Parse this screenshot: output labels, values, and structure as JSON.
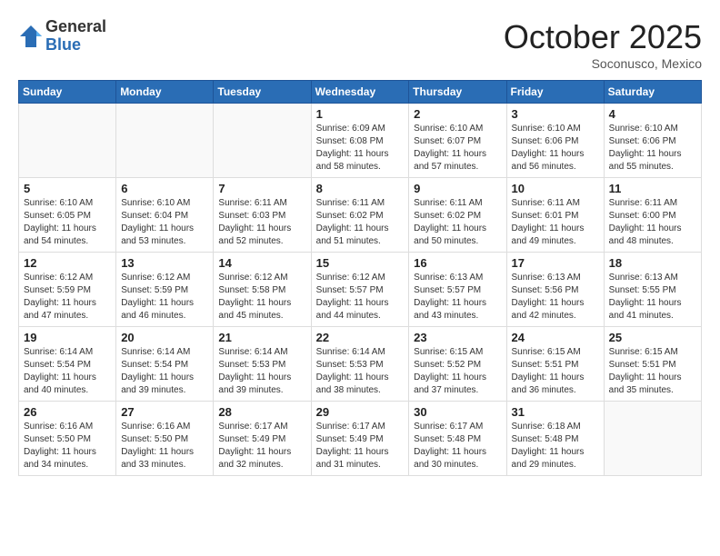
{
  "logo": {
    "general": "General",
    "blue": "Blue"
  },
  "header": {
    "month": "October 2025",
    "location": "Soconusco, Mexico"
  },
  "weekdays": [
    "Sunday",
    "Monday",
    "Tuesday",
    "Wednesday",
    "Thursday",
    "Friday",
    "Saturday"
  ],
  "weeks": [
    [
      {
        "day": "",
        "info": ""
      },
      {
        "day": "",
        "info": ""
      },
      {
        "day": "",
        "info": ""
      },
      {
        "day": "1",
        "info": "Sunrise: 6:09 AM\nSunset: 6:08 PM\nDaylight: 11 hours\nand 58 minutes."
      },
      {
        "day": "2",
        "info": "Sunrise: 6:10 AM\nSunset: 6:07 PM\nDaylight: 11 hours\nand 57 minutes."
      },
      {
        "day": "3",
        "info": "Sunrise: 6:10 AM\nSunset: 6:06 PM\nDaylight: 11 hours\nand 56 minutes."
      },
      {
        "day": "4",
        "info": "Sunrise: 6:10 AM\nSunset: 6:06 PM\nDaylight: 11 hours\nand 55 minutes."
      }
    ],
    [
      {
        "day": "5",
        "info": "Sunrise: 6:10 AM\nSunset: 6:05 PM\nDaylight: 11 hours\nand 54 minutes."
      },
      {
        "day": "6",
        "info": "Sunrise: 6:10 AM\nSunset: 6:04 PM\nDaylight: 11 hours\nand 53 minutes."
      },
      {
        "day": "7",
        "info": "Sunrise: 6:11 AM\nSunset: 6:03 PM\nDaylight: 11 hours\nand 52 minutes."
      },
      {
        "day": "8",
        "info": "Sunrise: 6:11 AM\nSunset: 6:02 PM\nDaylight: 11 hours\nand 51 minutes."
      },
      {
        "day": "9",
        "info": "Sunrise: 6:11 AM\nSunset: 6:02 PM\nDaylight: 11 hours\nand 50 minutes."
      },
      {
        "day": "10",
        "info": "Sunrise: 6:11 AM\nSunset: 6:01 PM\nDaylight: 11 hours\nand 49 minutes."
      },
      {
        "day": "11",
        "info": "Sunrise: 6:11 AM\nSunset: 6:00 PM\nDaylight: 11 hours\nand 48 minutes."
      }
    ],
    [
      {
        "day": "12",
        "info": "Sunrise: 6:12 AM\nSunset: 5:59 PM\nDaylight: 11 hours\nand 47 minutes."
      },
      {
        "day": "13",
        "info": "Sunrise: 6:12 AM\nSunset: 5:59 PM\nDaylight: 11 hours\nand 46 minutes."
      },
      {
        "day": "14",
        "info": "Sunrise: 6:12 AM\nSunset: 5:58 PM\nDaylight: 11 hours\nand 45 minutes."
      },
      {
        "day": "15",
        "info": "Sunrise: 6:12 AM\nSunset: 5:57 PM\nDaylight: 11 hours\nand 44 minutes."
      },
      {
        "day": "16",
        "info": "Sunrise: 6:13 AM\nSunset: 5:57 PM\nDaylight: 11 hours\nand 43 minutes."
      },
      {
        "day": "17",
        "info": "Sunrise: 6:13 AM\nSunset: 5:56 PM\nDaylight: 11 hours\nand 42 minutes."
      },
      {
        "day": "18",
        "info": "Sunrise: 6:13 AM\nSunset: 5:55 PM\nDaylight: 11 hours\nand 41 minutes."
      }
    ],
    [
      {
        "day": "19",
        "info": "Sunrise: 6:14 AM\nSunset: 5:54 PM\nDaylight: 11 hours\nand 40 minutes."
      },
      {
        "day": "20",
        "info": "Sunrise: 6:14 AM\nSunset: 5:54 PM\nDaylight: 11 hours\nand 39 minutes."
      },
      {
        "day": "21",
        "info": "Sunrise: 6:14 AM\nSunset: 5:53 PM\nDaylight: 11 hours\nand 39 minutes."
      },
      {
        "day": "22",
        "info": "Sunrise: 6:14 AM\nSunset: 5:53 PM\nDaylight: 11 hours\nand 38 minutes."
      },
      {
        "day": "23",
        "info": "Sunrise: 6:15 AM\nSunset: 5:52 PM\nDaylight: 11 hours\nand 37 minutes."
      },
      {
        "day": "24",
        "info": "Sunrise: 6:15 AM\nSunset: 5:51 PM\nDaylight: 11 hours\nand 36 minutes."
      },
      {
        "day": "25",
        "info": "Sunrise: 6:15 AM\nSunset: 5:51 PM\nDaylight: 11 hours\nand 35 minutes."
      }
    ],
    [
      {
        "day": "26",
        "info": "Sunrise: 6:16 AM\nSunset: 5:50 PM\nDaylight: 11 hours\nand 34 minutes."
      },
      {
        "day": "27",
        "info": "Sunrise: 6:16 AM\nSunset: 5:50 PM\nDaylight: 11 hours\nand 33 minutes."
      },
      {
        "day": "28",
        "info": "Sunrise: 6:17 AM\nSunset: 5:49 PM\nDaylight: 11 hours\nand 32 minutes."
      },
      {
        "day": "29",
        "info": "Sunrise: 6:17 AM\nSunset: 5:49 PM\nDaylight: 11 hours\nand 31 minutes."
      },
      {
        "day": "30",
        "info": "Sunrise: 6:17 AM\nSunset: 5:48 PM\nDaylight: 11 hours\nand 30 minutes."
      },
      {
        "day": "31",
        "info": "Sunrise: 6:18 AM\nSunset: 5:48 PM\nDaylight: 11 hours\nand 29 minutes."
      },
      {
        "day": "",
        "info": ""
      }
    ]
  ]
}
